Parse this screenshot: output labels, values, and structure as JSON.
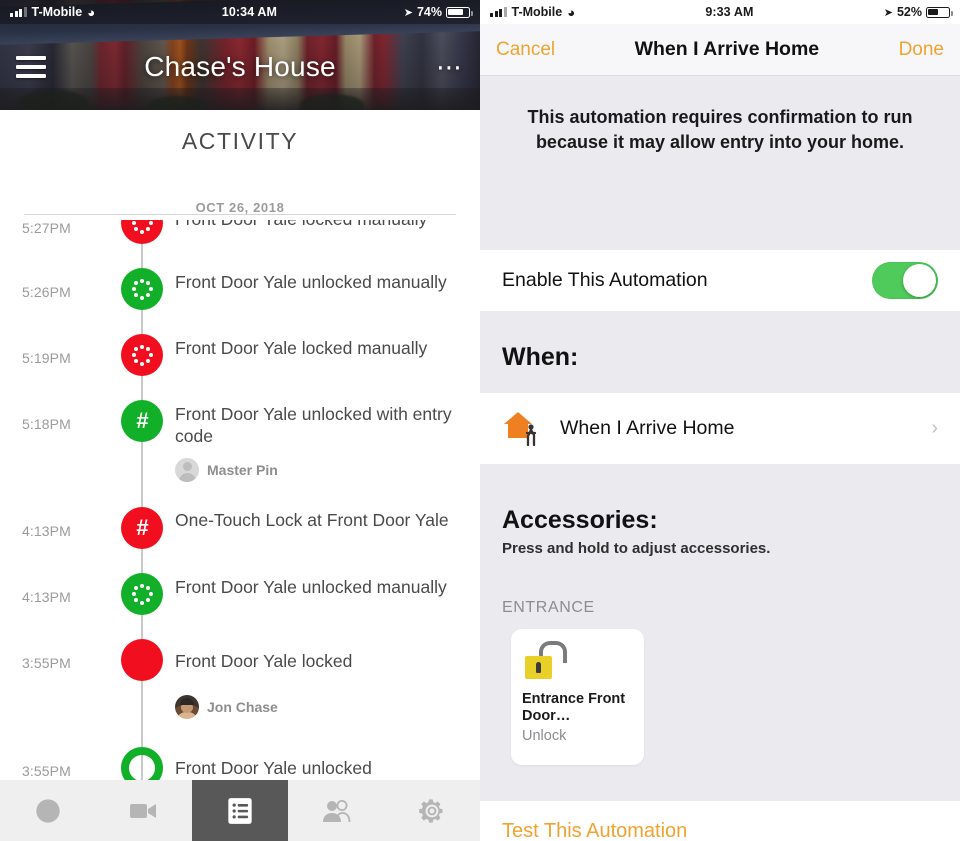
{
  "left": {
    "status_bar": {
      "carrier": "T-Mobile",
      "wifi_icon": "wifi-icon",
      "time": "10:34 AM",
      "location_icon": "location-arrow-icon",
      "battery": "74%"
    },
    "header": {
      "menu_icon": "hamburger-menu-icon",
      "title": "Chase's House",
      "more_icon": "more-options-icon"
    },
    "section_title": "ACTIVITY",
    "date_header": "OCT 26, 2018",
    "events": [
      {
        "time": "5:27PM",
        "text": "Front Door Yale locked manually",
        "dot": "red",
        "icon": "manual-dots-icon",
        "sub": null
      },
      {
        "time": "5:26PM",
        "text": "Front Door Yale unlocked manually",
        "dot": "green",
        "icon": "manual-dots-icon",
        "sub": null
      },
      {
        "time": "5:19PM",
        "text": "Front Door Yale locked manually",
        "dot": "red",
        "icon": "manual-dots-icon",
        "sub": null
      },
      {
        "time": "5:18PM",
        "text": "Front Door Yale unlocked with entry code",
        "dot": "green",
        "icon": "keypad-hash-icon",
        "sub": "Master Pin",
        "sub_avatar": "blank"
      },
      {
        "time": "4:13PM",
        "text": "One-Touch Lock at Front Door Yale",
        "dot": "red",
        "icon": "keypad-hash-icon",
        "sub": null
      },
      {
        "time": "4:13PM",
        "text": "Front Door Yale unlocked manually",
        "dot": "green",
        "icon": "manual-dots-icon",
        "sub": null
      },
      {
        "time": "3:55PM",
        "text": "Front Door Yale locked",
        "dot": "red",
        "icon": "solid-icon",
        "sub": "Jon Chase",
        "sub_avatar": "photo"
      },
      {
        "time": "3:55PM",
        "text": "Front Door Yale unlocked",
        "dot": "ring",
        "icon": "ring-icon",
        "sub": null
      }
    ],
    "tabs": [
      {
        "name": "lock-tab",
        "icon": "circle-lock-icon",
        "active": false
      },
      {
        "name": "camera-tab",
        "icon": "video-camera-icon",
        "active": false
      },
      {
        "name": "activity-tab",
        "icon": "list-icon",
        "active": true
      },
      {
        "name": "guests-tab",
        "icon": "people-icon",
        "active": false
      },
      {
        "name": "settings-tab",
        "icon": "gear-icon",
        "active": false
      }
    ]
  },
  "right": {
    "status_bar": {
      "carrier": "T-Mobile",
      "wifi_icon": "wifi-icon",
      "time": "9:33 AM",
      "location_icon": "location-arrow-icon",
      "battery": "52%"
    },
    "nav": {
      "cancel": "Cancel",
      "title": "When I Arrive Home",
      "done": "Done"
    },
    "info_text": "This automation requires confirmation to run because it may allow entry into your home.",
    "enable_row": {
      "label": "Enable This Automation",
      "toggle_on": true
    },
    "when": {
      "heading": "When:",
      "trigger_label": "When I Arrive Home",
      "trigger_icon": "home-arrive-icon",
      "chevron": "›"
    },
    "accessories": {
      "heading": "Accessories:",
      "subtitle": "Press and hold to adjust accessories.",
      "group_label": "ENTRANCE",
      "tiles": [
        {
          "icon": "unlocked-padlock-icon",
          "name": "Entrance Front Door…",
          "state": "Unlock"
        }
      ]
    },
    "test_link": "Test This Automation"
  },
  "colors": {
    "accent_orange": "#f0a330",
    "toggle_green": "#4ecb5a",
    "dot_green": "#12b028",
    "dot_red": "#f10f1f",
    "lock_yellow": "#e8d028",
    "bg_gray": "#eaeaef"
  }
}
